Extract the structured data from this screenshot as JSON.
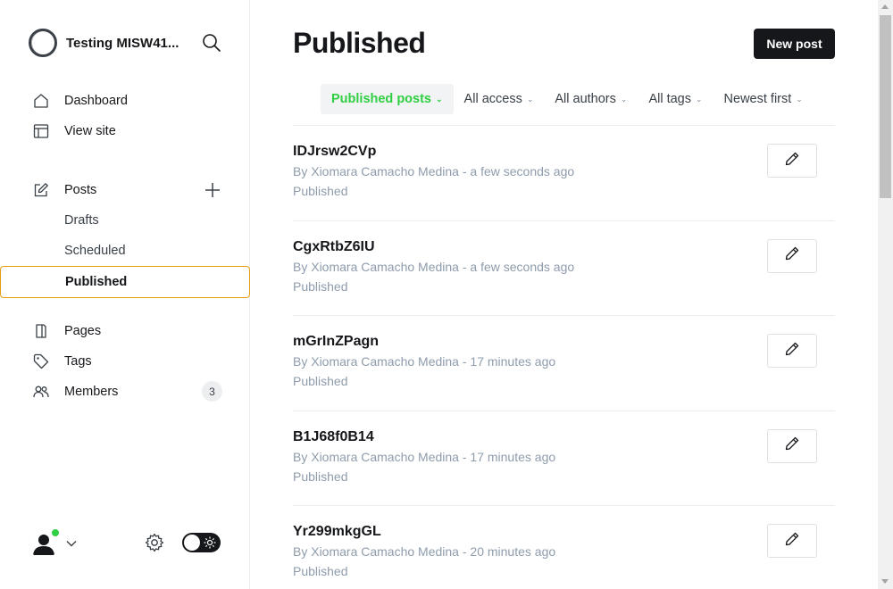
{
  "app": {
    "site_name": "Testing MISW41...",
    "page_title": "Published",
    "new_post_label": "New post"
  },
  "sidebar": {
    "items": [
      {
        "label": "Dashboard",
        "icon": "home-icon"
      },
      {
        "label": "View site",
        "icon": "layout-icon"
      },
      {
        "label": "Posts",
        "icon": "edit-icon"
      },
      {
        "label": "Drafts"
      },
      {
        "label": "Scheduled"
      },
      {
        "label": "Published"
      },
      {
        "label": "Pages",
        "icon": "page-icon"
      },
      {
        "label": "Tags",
        "icon": "tag-icon"
      },
      {
        "label": "Members",
        "icon": "members-icon",
        "badge": "3"
      }
    ]
  },
  "filters": [
    {
      "label": "Published posts",
      "selected": true
    },
    {
      "label": "All access"
    },
    {
      "label": "All authors"
    },
    {
      "label": "All tags"
    },
    {
      "label": "Newest first"
    }
  ],
  "posts": [
    {
      "title": "IDJrsw2CVp",
      "meta": "By Xiomara Camacho Medina - a few seconds ago",
      "status": "Published"
    },
    {
      "title": "CgxRtbZ6IU",
      "meta": "By Xiomara Camacho Medina - a few seconds ago",
      "status": "Published"
    },
    {
      "title": "mGrInZPagn",
      "meta": "By Xiomara Camacho Medina - 17 minutes ago",
      "status": "Published"
    },
    {
      "title": "B1J68f0B14",
      "meta": "By Xiomara Camacho Medina - 17 minutes ago",
      "status": "Published"
    },
    {
      "title": "Yr299mkgGL",
      "meta": "By Xiomara Camacho Medina - 20 minutes ago",
      "status": "Published"
    }
  ],
  "colors": {
    "accent_green": "#30cf43",
    "active_outline": "#e8a012",
    "primary_dark": "#15171a",
    "muted_text": "#8e9cac"
  }
}
